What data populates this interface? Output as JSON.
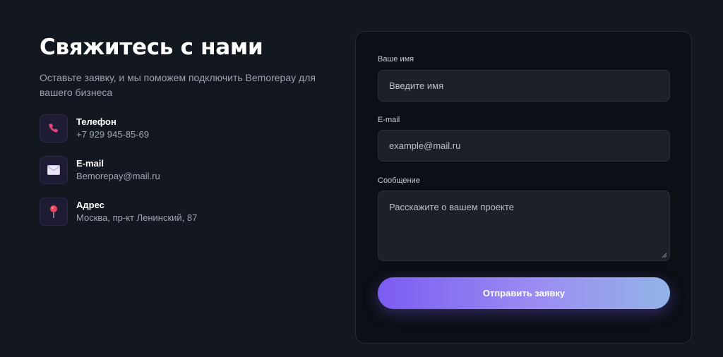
{
  "header": {
    "title": "Свяжитесь с нами",
    "subtitle": "Оставьте заявку, и мы поможем подключить Bemorepay для вашего бизнеса"
  },
  "contacts": [
    {
      "icon": "phone-icon",
      "label": "Телефон",
      "value": "+7 929 945-85-69"
    },
    {
      "icon": "envelope-icon",
      "label": "E-mail",
      "value": "Bemorepay@mail.ru"
    },
    {
      "icon": "pushpin-icon",
      "label": "Адрес",
      "value": "Москва, пр-кт Ленинский, 87"
    }
  ],
  "form": {
    "name": {
      "label": "Ваше имя",
      "placeholder": "Введите имя"
    },
    "email": {
      "label": "E-mail",
      "placeholder": "example@mail.ru"
    },
    "message": {
      "label": "Сообщение",
      "placeholder": "Расскажите о вашем проекте"
    },
    "submit_label": "Отправить заявку"
  },
  "colors": {
    "background": "#131720",
    "card": "#0c0f16",
    "accent_start": "#7c5cf2",
    "accent_end": "#93b4e8"
  }
}
